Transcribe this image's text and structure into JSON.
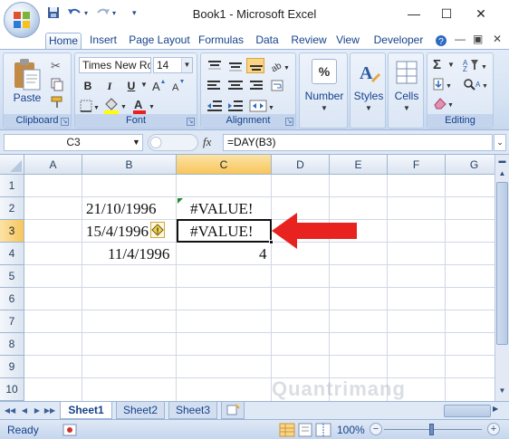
{
  "window": {
    "title": "Book1 - Microsoft Excel",
    "minimize": "—",
    "maximize": "☐",
    "close": "✕"
  },
  "ribbon_tabs": [
    "Home",
    "Insert",
    "Page Layout",
    "Formulas",
    "Data",
    "Review",
    "View",
    "Developer"
  ],
  "active_tab": "Home",
  "ribbon": {
    "clipboard": {
      "label": "Clipboard",
      "paste": "Paste"
    },
    "font": {
      "label": "Font",
      "name": "Times New Ro",
      "size": "14",
      "bold": "B",
      "italic": "I",
      "underline": "U"
    },
    "alignment": {
      "label": "Alignment"
    },
    "number": {
      "label": "Number",
      "symbol": "%"
    },
    "styles": {
      "label": "Styles"
    },
    "cells": {
      "label": "Cells"
    },
    "editing": {
      "label": "Editing",
      "sum": "Σ"
    }
  },
  "formula_bar": {
    "name_box": "C3",
    "fx": "fx",
    "formula": "=DAY(B3)"
  },
  "columns": [
    "A",
    "B",
    "C",
    "D",
    "E",
    "F",
    "G"
  ],
  "selected_column": "C",
  "rows": [
    "1",
    "2",
    "3",
    "4",
    "5",
    "6",
    "7",
    "8",
    "9",
    "10"
  ],
  "selected_row": "3",
  "cells": {
    "B2": "21/10/1996",
    "C2": "#VALUE!",
    "B3": "15/4/1996",
    "C3": "#VALUE!",
    "B4": "11/4/1996",
    "C4": "4"
  },
  "sheets": [
    "Sheet1",
    "Sheet2",
    "Sheet3"
  ],
  "active_sheet": "Sheet1",
  "status": {
    "text": "Ready",
    "zoom": "100%"
  },
  "watermark": "Quantrimang",
  "colors": {
    "selected_header": "#f8c55b",
    "arrow": "#e8231f",
    "accent": "#15428b"
  }
}
